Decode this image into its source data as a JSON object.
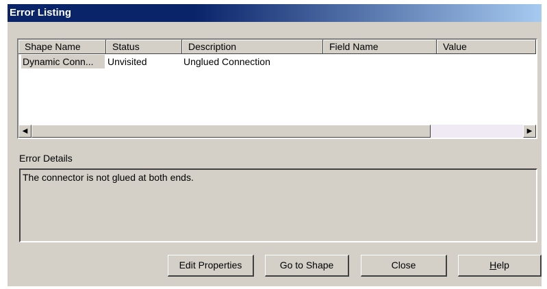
{
  "window": {
    "title": "Error Listing"
  },
  "list": {
    "columns": [
      "Shape Name",
      "Status",
      "Description",
      "Field Name",
      "Value"
    ],
    "rows": [
      {
        "shape_name": "Dynamic Conn...",
        "status": "Unvisited",
        "description": "Unglued Connection",
        "field_name": "",
        "value": ""
      }
    ],
    "scroll_left_icon": "arrow-left",
    "scroll_right_icon": "arrow-right"
  },
  "details": {
    "label": "Error Details",
    "text": "The connector is not glued at both ends."
  },
  "buttons": {
    "edit_properties": "Edit Properties",
    "go_to_shape": "Go to Shape",
    "close": "Close",
    "help_prefix": "H",
    "help_rest": "elp"
  }
}
